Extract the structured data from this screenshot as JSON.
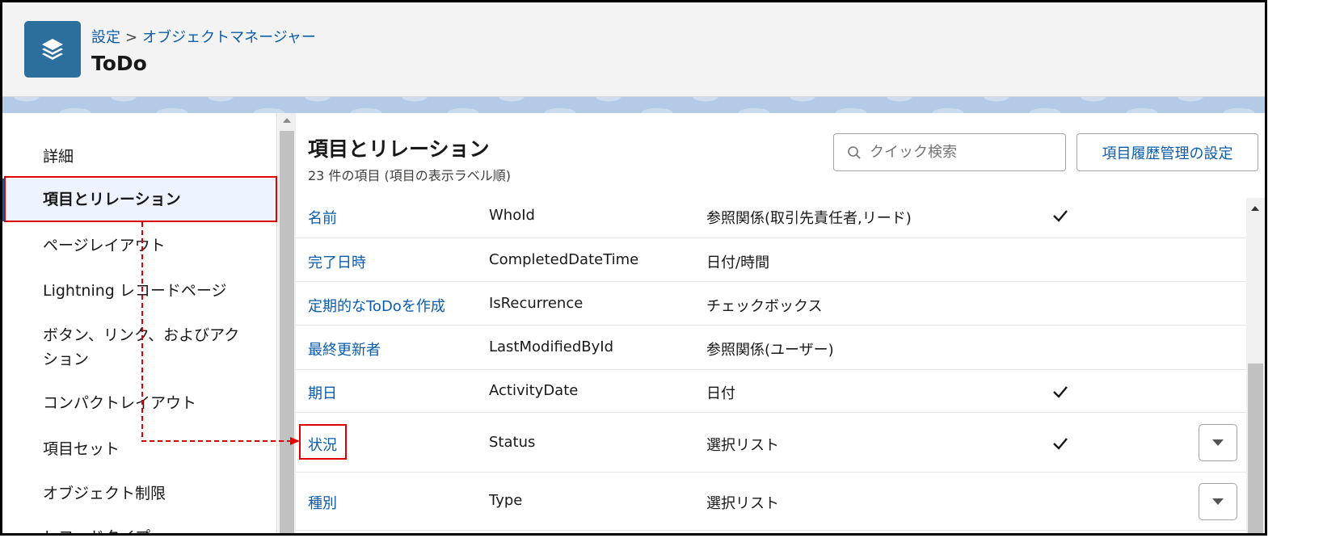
{
  "header": {
    "breadcrumb_root": "設定",
    "breadcrumb_sep": ">",
    "breadcrumb_current": "オブジェクトマネージャー",
    "title": "ToDo",
    "icon": "layers-icon"
  },
  "sidebar": {
    "items": [
      {
        "label": "詳細"
      },
      {
        "label": "項目とリレーション",
        "active": true
      },
      {
        "label": "ページレイアウト"
      },
      {
        "label": "Lightning レコードページ"
      },
      {
        "label": "ボタン、リンク、およびアクション"
      },
      {
        "label": "コンパクトレイアウト"
      },
      {
        "label": "項目セット"
      },
      {
        "label": "オブジェクト制限"
      },
      {
        "label": "レコードタイプ"
      }
    ]
  },
  "main": {
    "title": "項目とリレーション",
    "subtitle": "23 件の項目 (項目の表示ラベル順)",
    "search_placeholder": "クイック検索",
    "history_button": "項目履歴管理の設定",
    "rows": [
      {
        "label": "名前",
        "api": "WhoId",
        "type": "参照関係(取引先責任者,リード)",
        "indexed": true,
        "menu": false
      },
      {
        "label": "完了日時",
        "api": "CompletedDateTime",
        "type": "日付/時間",
        "indexed": false,
        "menu": false
      },
      {
        "label": "定期的なToDoを作成",
        "api": "IsRecurrence",
        "type": "チェックボックス",
        "indexed": false,
        "menu": false
      },
      {
        "label": "最終更新者",
        "api": "LastModifiedById",
        "type": "参照関係(ユーザー)",
        "indexed": false,
        "menu": false
      },
      {
        "label": "期日",
        "api": "ActivityDate",
        "type": "日付",
        "indexed": true,
        "menu": false
      },
      {
        "label": "状況",
        "api": "Status",
        "type": "選択リスト",
        "indexed": true,
        "menu": true
      },
      {
        "label": "種別",
        "api": "Type",
        "type": "選択リスト",
        "indexed": false,
        "menu": true
      }
    ]
  },
  "colors": {
    "accent": "#0b5cab",
    "app_icon": "#2c6e9e",
    "annotation": "#e00000"
  }
}
